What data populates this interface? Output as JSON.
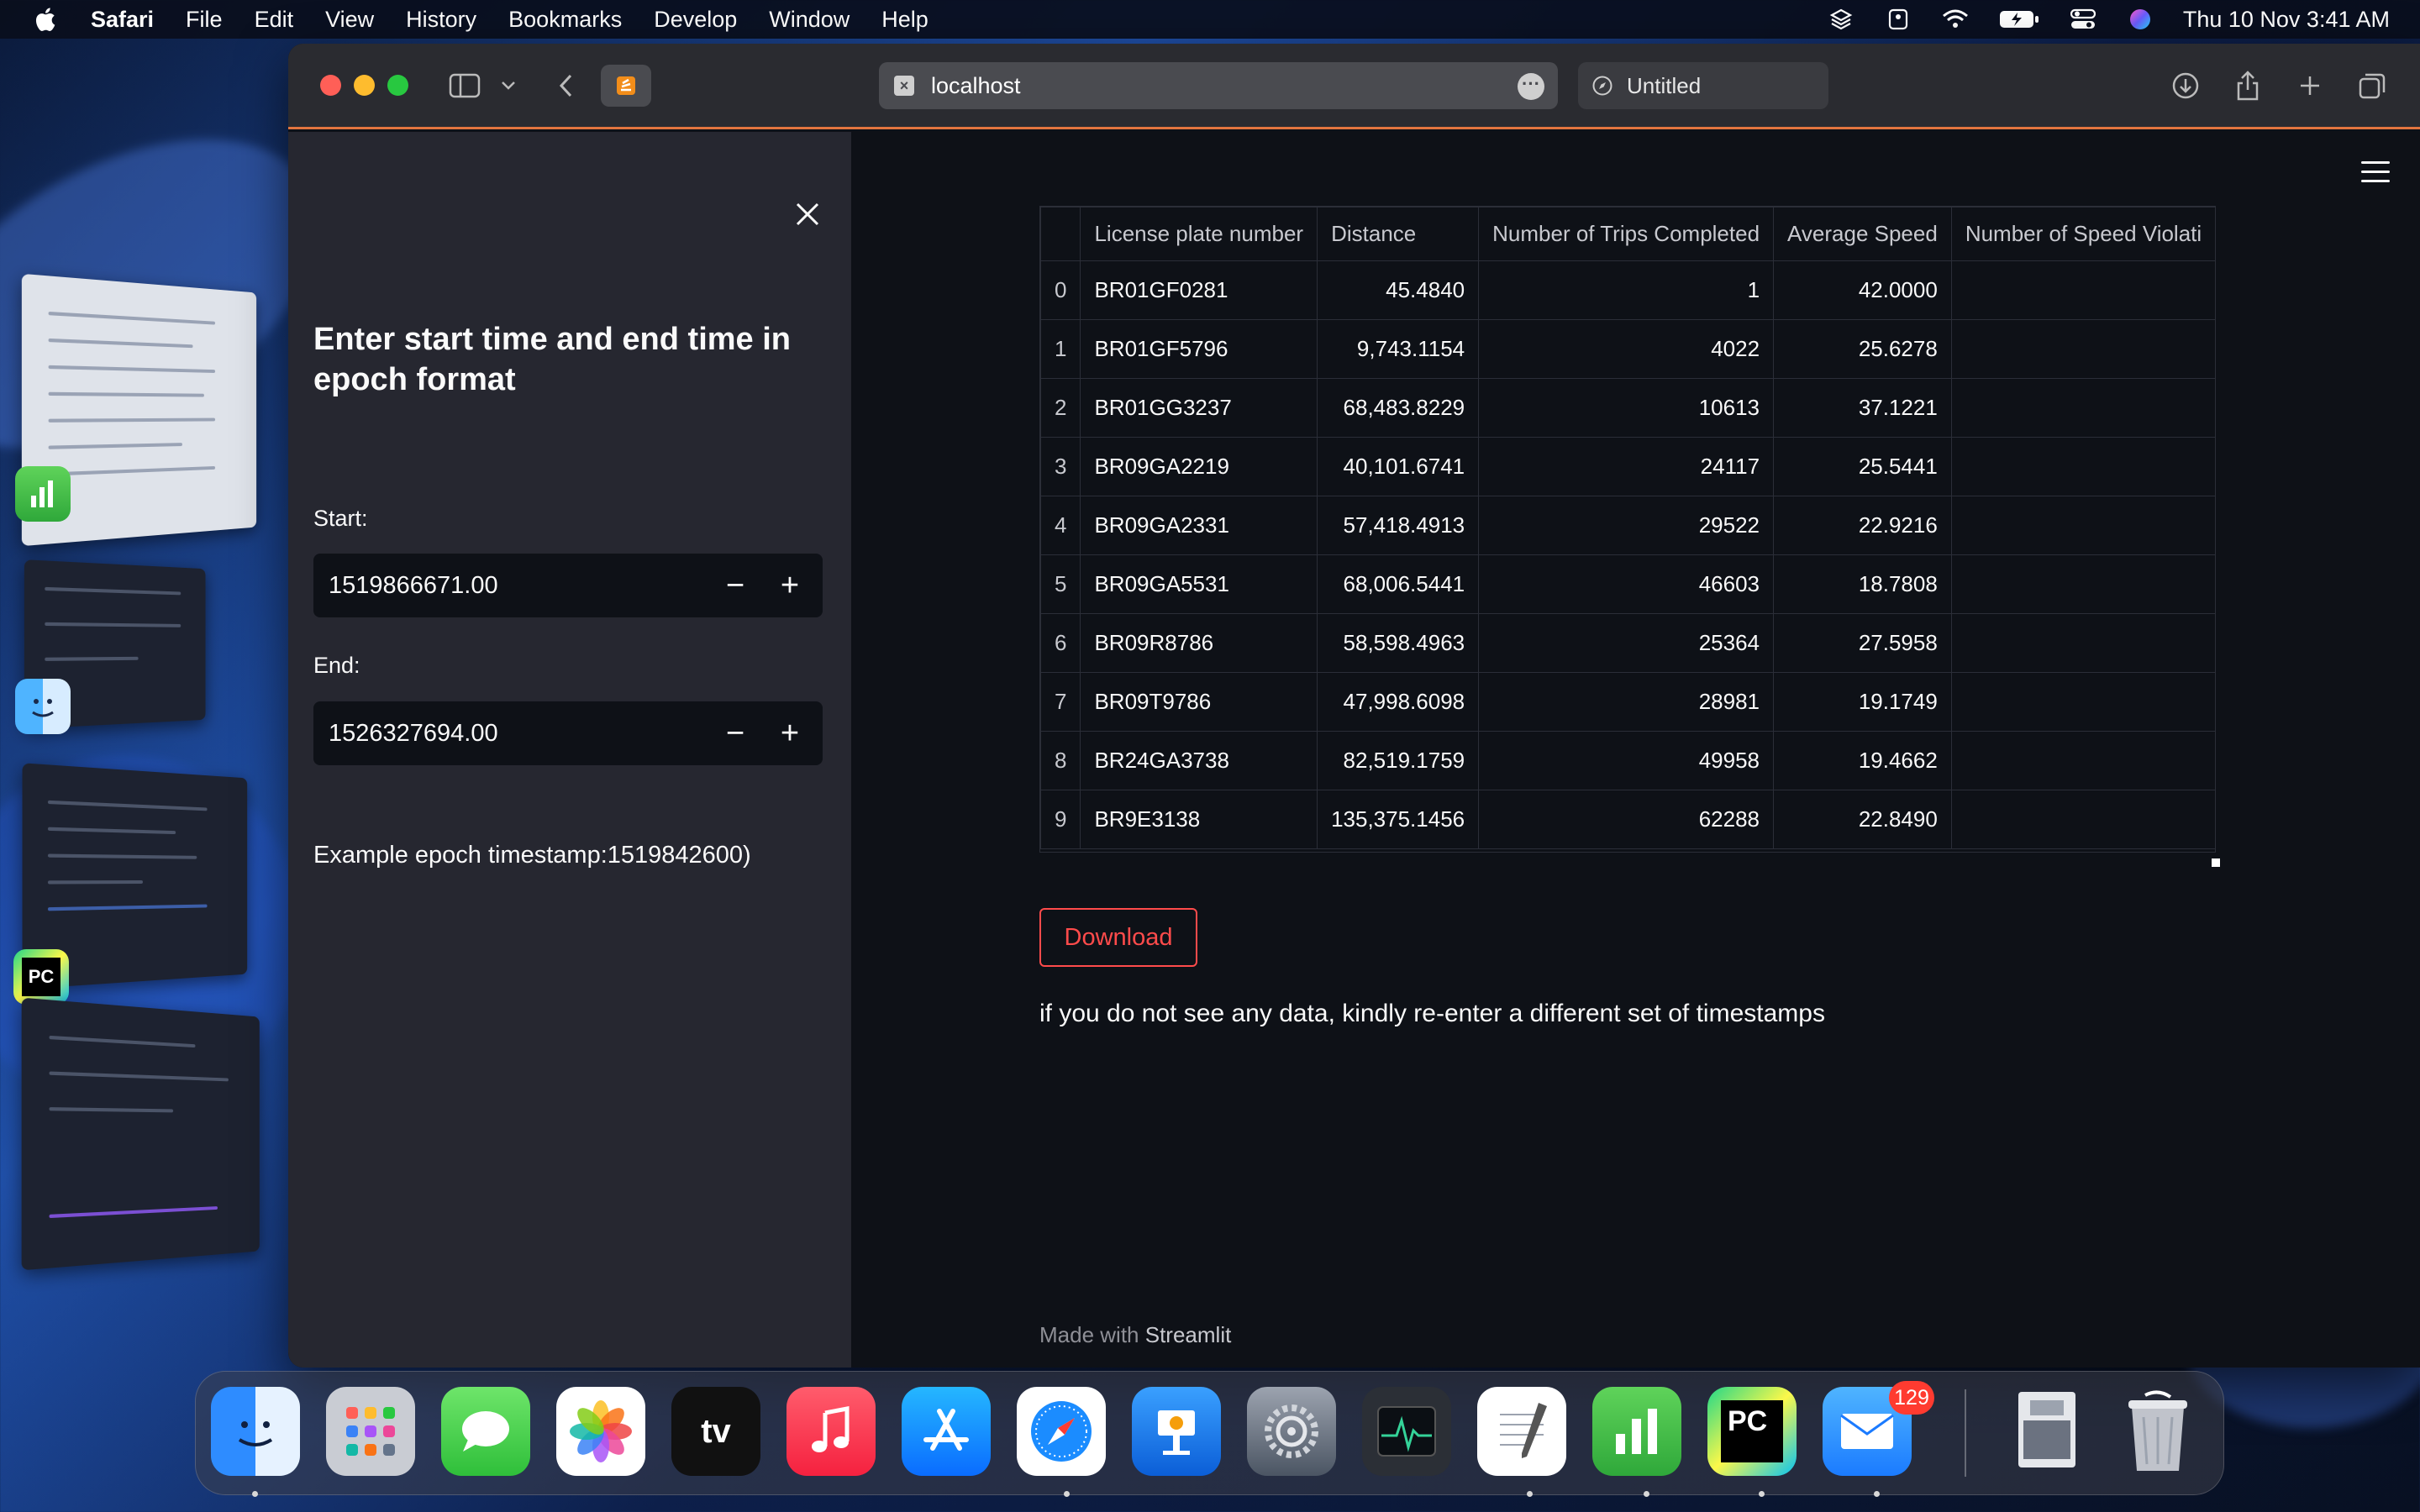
{
  "menubar": {
    "app_name": "Safari",
    "items": [
      "File",
      "Edit",
      "View",
      "History",
      "Bookmarks",
      "Develop",
      "Window",
      "Help"
    ],
    "clock": "Thu 10 Nov  3:41 AM"
  },
  "browser": {
    "url": "localhost",
    "tab_title": "Untitled"
  },
  "sidebar": {
    "title": "Enter start time and end time in epoch format",
    "start_label": "Start:",
    "start_value": "1519866671.00",
    "end_label": "End:",
    "end_value": "1526327694.00",
    "minus": "−",
    "plus": "+",
    "example_text": "Example epoch timestamp:1519842600)"
  },
  "table": {
    "columns": [
      "",
      "License plate number",
      "Distance",
      "Number of Trips Completed",
      "Average Speed",
      "Number of Speed Violati"
    ],
    "rows": [
      [
        "0",
        "BR01GF0281",
        "45.4840",
        "1",
        "42.0000",
        ""
      ],
      [
        "1",
        "BR01GF5796",
        "9,743.1154",
        "4022",
        "25.6278",
        ""
      ],
      [
        "2",
        "BR01GG3237",
        "68,483.8229",
        "10613",
        "37.1221",
        ""
      ],
      [
        "3",
        "BR09GA2219",
        "40,101.6741",
        "24117",
        "25.5441",
        ""
      ],
      [
        "4",
        "BR09GA2331",
        "57,418.4913",
        "29522",
        "22.9216",
        ""
      ],
      [
        "5",
        "BR09GA5531",
        "68,006.5441",
        "46603",
        "18.7808",
        ""
      ],
      [
        "6",
        "BR09R8786",
        "58,598.4963",
        "25364",
        "27.5958",
        ""
      ],
      [
        "7",
        "BR09T9786",
        "47,998.6098",
        "28981",
        "19.1749",
        ""
      ],
      [
        "8",
        "BR24GA3738",
        "82,519.1759",
        "49958",
        "19.4662",
        ""
      ],
      [
        "9",
        "BR9E3138",
        "135,375.1456",
        "62288",
        "22.8490",
        ""
      ]
    ]
  },
  "main": {
    "download_label": "Download",
    "info_text": "if you do not see any data, kindly re-enter a different set of timestamps",
    "footer_prefix": "Made with ",
    "footer_brand": "Streamlit"
  },
  "dock": {
    "mail_badge": "129",
    "pycharm_label": "PC",
    "thumb_pycharm_label": "PC",
    "appletv_label": "tv"
  },
  "colors": {
    "accent_red": "#ff4b4b",
    "sidebar_bg": "#262730",
    "main_bg": "#0e1117"
  }
}
